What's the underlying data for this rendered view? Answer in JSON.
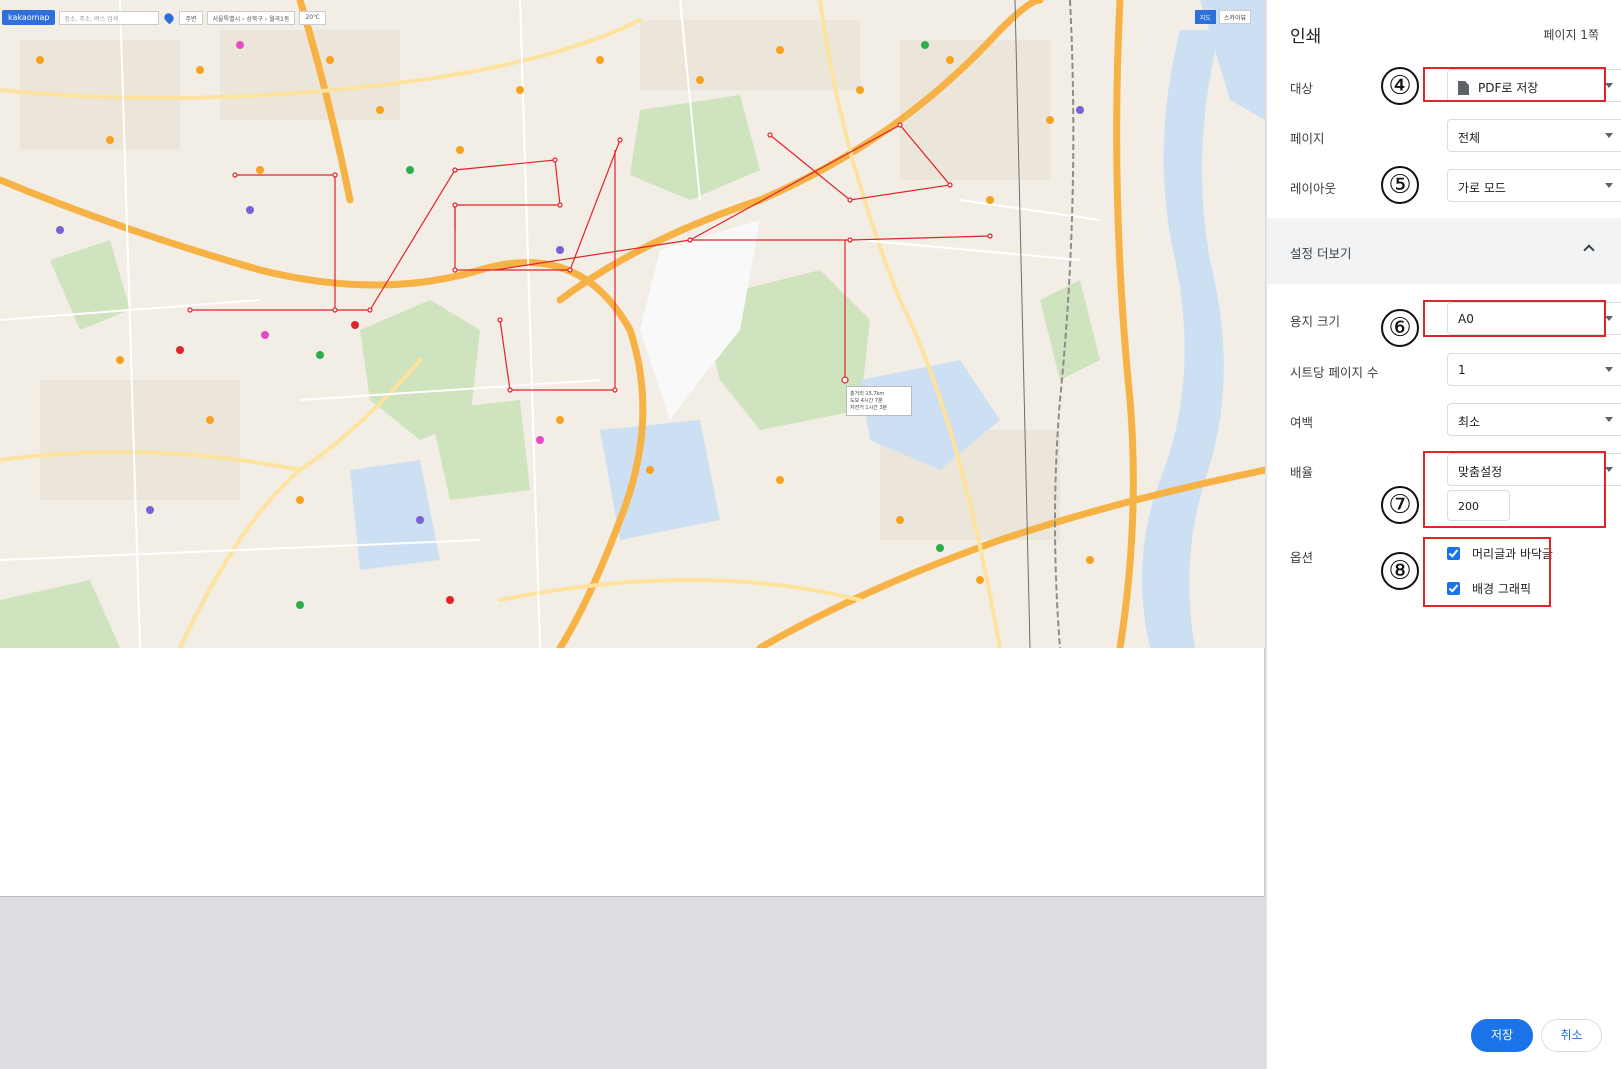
{
  "map": {
    "logo": "kakaomap",
    "search_placeholder": "장소, 주소, 버스 검색",
    "route_label": "주변",
    "breadcrumb": "서울특별시 › 성북구 › 월곡1동",
    "weather": "20℃",
    "view_buttons": [
      "지도",
      "스카이뷰"
    ],
    "popup_lines": [
      "총거리 15.7km",
      "도보 4시간 7분",
      "자전거 1시간 3분"
    ],
    "accent_color": "#2f6fdc",
    "route_color": "#e0242b"
  },
  "panel": {
    "title": "인쇄",
    "page_count": "페이지 1쪽",
    "destination": {
      "label": "대상",
      "value": "PDF로 저장",
      "icon": "document-icon"
    },
    "pages": {
      "label": "페이지",
      "value": "전체"
    },
    "layout": {
      "label": "레이아웃",
      "value": "가로 모드"
    },
    "more_settings": {
      "label": "설정 더보기",
      "icon": "chevron-up-icon"
    },
    "paper_size": {
      "label": "용지 크기",
      "value": "A0"
    },
    "pages_per_sheet": {
      "label": "시트당 페이지 수",
      "value": "1"
    },
    "margins": {
      "label": "여백",
      "value": "최소"
    },
    "scale": {
      "label": "배율",
      "value": "맞춤설정",
      "input_value": "200"
    },
    "options": {
      "label": "옵션",
      "items": [
        {
          "label": "머리글과 바닥글",
          "checked": true
        },
        {
          "label": "배경 그래픽",
          "checked": true
        }
      ]
    },
    "save_label": "저장",
    "cancel_label": "취소",
    "primary_color": "#1a73e8"
  },
  "annotations": {
    "steps": [
      "④",
      "⑤",
      "⑥",
      "⑦",
      "⑧"
    ],
    "highlight_color": "#e0242b"
  }
}
